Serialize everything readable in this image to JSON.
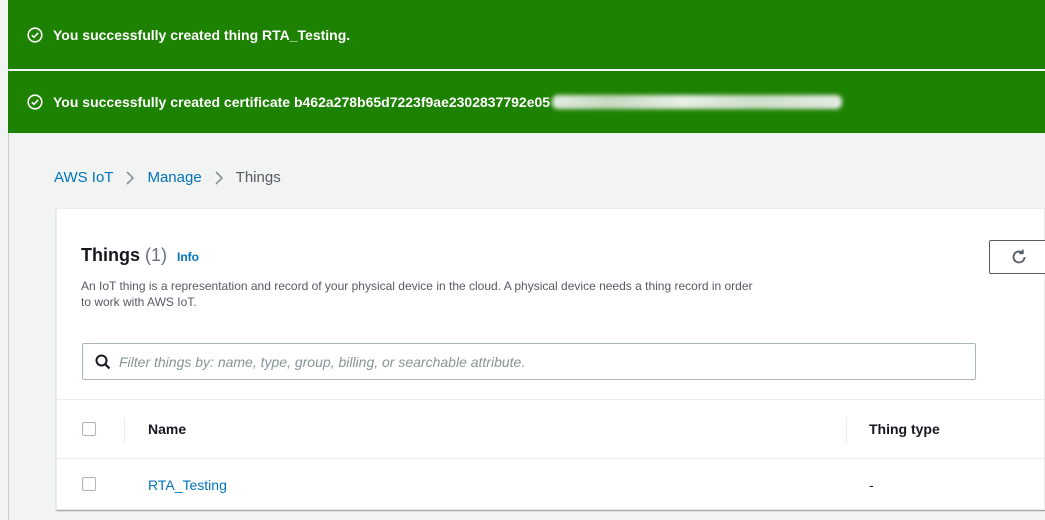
{
  "notifications": [
    {
      "message": "You successfully created thing RTA_Testing.",
      "icon": "check-circle-icon"
    },
    {
      "message": "You successfully created certificate b462a278b65d7223f9ae2302837792e05",
      "icon": "check-circle-icon"
    }
  ],
  "breadcrumb": {
    "items": [
      "AWS IoT",
      "Manage"
    ],
    "current": "Things"
  },
  "panel": {
    "title": "Things",
    "count": "(1)",
    "info_label": "Info",
    "description": "An IoT thing is a representation and record of your physical device in the cloud. A physical device needs a thing record in order to work with AWS IoT.",
    "refresh_icon": "refresh-icon"
  },
  "search": {
    "placeholder": "Filter things by: name, type, group, billing, or searchable attribute.",
    "value": ""
  },
  "table": {
    "columns": [
      "Name",
      "Thing type"
    ],
    "rows": [
      {
        "name": "RTA_Testing",
        "thing_type": "-"
      }
    ]
  },
  "colors": {
    "success": "#1d8102",
    "link": "#0073bb",
    "background": "#f2f3f3"
  }
}
